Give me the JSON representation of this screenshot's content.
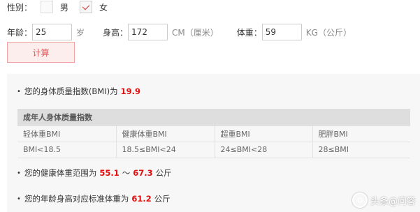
{
  "gender": {
    "label": "性别：",
    "options": [
      {
        "label": "男",
        "checked": false
      },
      {
        "label": "女",
        "checked": true
      }
    ]
  },
  "inputs": {
    "age_label": "年龄：",
    "age_value": "25",
    "age_unit": "岁",
    "height_label": "身高：",
    "height_value": "172",
    "height_unit": "CM（厘米）",
    "weight_label": "体重：",
    "weight_value": "59",
    "weight_unit": "KG（公斤）"
  },
  "calc_button": "计算",
  "results": {
    "bmi_prefix": "您的身体质量指数(BMI)为",
    "bmi_value": "19.9",
    "table": {
      "title": "成年人身体质量指数",
      "headers": [
        "轻体重BMI",
        "健康体重BMI",
        "超重BMI",
        "肥胖BMI"
      ],
      "values": [
        "BMI<18.5",
        "18.5≤BMI<24",
        "24≤BMI<28",
        "28≤BMI"
      ]
    },
    "range_prefix": "您的健康体重范围为",
    "range_low": "55.1",
    "range_sep": "～",
    "range_high": "67.3",
    "range_unit": "公斤",
    "std_prefix": "您的年龄身高对应标准体重为",
    "std_value": "61.2",
    "std_unit": "公斤"
  },
  "watermark": "头条@问答",
  "colors": {
    "accent_red": "#e01010",
    "button_bg": "#fdeeee",
    "button_border": "#f3a0a0",
    "panel_bg": "#f7f7f7"
  }
}
